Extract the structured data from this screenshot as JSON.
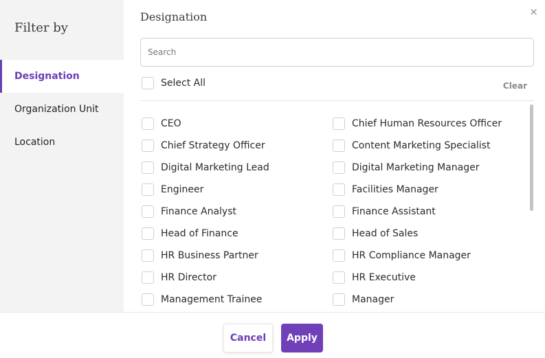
{
  "sidebar": {
    "title": "Filter by",
    "items": [
      {
        "label": "Designation",
        "active": true
      },
      {
        "label": "Organization Unit",
        "active": false
      },
      {
        "label": "Location",
        "active": false
      }
    ]
  },
  "main": {
    "close_glyph": "×",
    "section_title": "Designation",
    "search": {
      "placeholder": "Search",
      "value": ""
    },
    "select_all_label": "Select All",
    "clear_label": "Clear",
    "options": [
      "CEO",
      "Chief Human Resources Officer",
      "Chief Strategy Officer",
      "Content Marketing Specialist",
      "Digital Marketing Lead",
      "Digital Marketing Manager",
      "Engineer",
      "Facilities Manager",
      "Finance Analyst",
      "Finance Assistant",
      "Head of Finance",
      "Head of Sales",
      "HR Business Partner",
      "HR Compliance Manager",
      "HR Director",
      "HR Executive",
      "Management Trainee",
      "Manager"
    ]
  },
  "footer": {
    "cancel_label": "Cancel",
    "apply_label": "Apply"
  },
  "colors": {
    "accent": "#6a3fb5",
    "apply_bg": "#7040b8",
    "sidebar_bg": "#f3f3f3"
  },
  "icons": {
    "close": "close-icon"
  }
}
